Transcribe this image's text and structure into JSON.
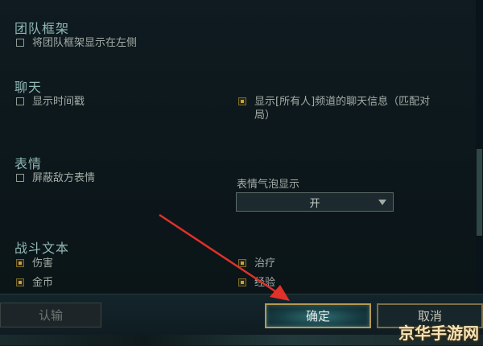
{
  "sections": {
    "team_frame": {
      "title": "团队框架",
      "options": [
        {
          "label": "将团队框架显示在左侧",
          "checked": false
        }
      ]
    },
    "chat": {
      "title": "聊天",
      "options": [
        {
          "label": "显示时间戳",
          "checked": false
        },
        {
          "label_line1": "显示[所有人]频道的聊天信息（匹配对",
          "label_line2": "局）",
          "checked": true
        }
      ]
    },
    "emote": {
      "title": "表情",
      "options": [
        {
          "label": "屏蔽敌方表情",
          "checked": false
        }
      ],
      "dropdown": {
        "label": "表情气泡显示",
        "value": "开"
      }
    },
    "combat_text": {
      "title": "战斗文本",
      "options": [
        {
          "label": "伤害",
          "checked": true
        },
        {
          "label": "治疗",
          "checked": true
        },
        {
          "label": "金币",
          "checked": true
        },
        {
          "label": "经验",
          "checked": true
        }
      ]
    }
  },
  "footer": {
    "surrender_label": "认输",
    "ok_label": "确定",
    "cancel_label": "取消"
  },
  "watermark": "京华手游网",
  "colors": {
    "accent_gold": "#c9a43a",
    "title_teal": "#8fb7b3",
    "annotation_red": "#e0312b"
  }
}
